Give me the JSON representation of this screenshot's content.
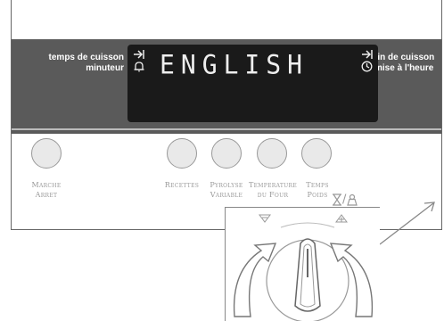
{
  "display": {
    "text": "ENGLISH",
    "left_top_icon": "end-time-arrow-icon",
    "left_bottom_icon": "bell-icon",
    "right_top_icon": "end-time-arrow-icon",
    "right_bottom_icon": "clock-icon"
  },
  "labels": {
    "cook_time": "temps de cuisson",
    "timer": "minuteur",
    "end_cook": "fin de cuisson",
    "set_clock": "mise à l'heure"
  },
  "buttons": [
    {
      "line1": "Marche",
      "line2": "Arret"
    },
    {
      "line1": "Recettes",
      "line2": ""
    },
    {
      "line1": "Pyrolyse",
      "line2": "Variable"
    },
    {
      "line1": "Temperature",
      "line2": "du Four"
    },
    {
      "line1": "Temps",
      "line2": "Poids"
    }
  ],
  "timer_icons": {
    "separator": "/"
  },
  "dial": {
    "minus": "−",
    "plus": "+"
  },
  "colors": {
    "band": "#5a5a5a",
    "display": "#1a1a1a"
  }
}
